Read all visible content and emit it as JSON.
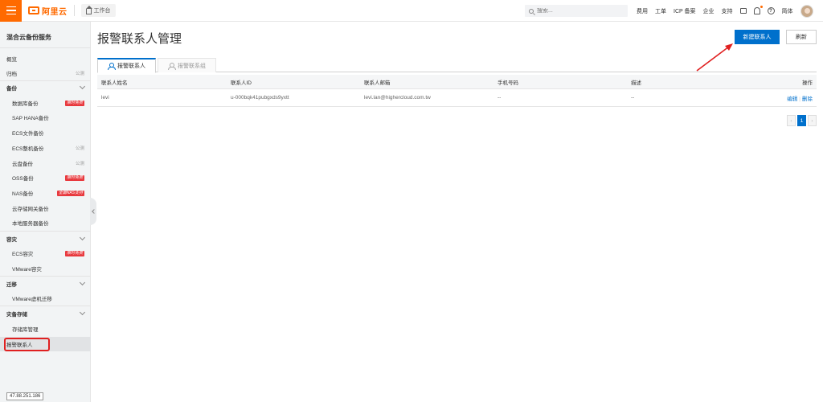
{
  "topbar": {
    "logo_text": "阿里云",
    "workbench_label": "工作台",
    "search_placeholder": "搜索...",
    "links": [
      "费用",
      "工单",
      "ICP 备案",
      "企业",
      "支持"
    ],
    "lang": "简体"
  },
  "sidebar": {
    "title": "混合云备份服务",
    "items": [
      {
        "label": "概览"
      },
      {
        "label": "归档",
        "tag": "公测"
      },
      {
        "label": "备份"
      },
      {
        "label": "数据库备份",
        "tag": "限时免费"
      },
      {
        "label": "SAP HANA备份"
      },
      {
        "label": "ECS文件备份"
      },
      {
        "label": "ECS整机备份",
        "tag": "公测"
      },
      {
        "label": "云盘备份",
        "tag": "公测"
      },
      {
        "label": "OSS备份",
        "tag": "限时免费"
      },
      {
        "label": "NAS备份",
        "tag": "全面NAS支持"
      },
      {
        "label": "云存储网关备份"
      },
      {
        "label": "本地服务器备份"
      },
      {
        "label": "容灾"
      },
      {
        "label": "ECS容灾",
        "tag": "限时免费"
      },
      {
        "label": "VMware容灾"
      },
      {
        "label": "迁移"
      },
      {
        "label": "VMware虚机迁移"
      },
      {
        "label": "灾备存储"
      },
      {
        "label": "存储库管理"
      },
      {
        "label": "报警联系人"
      }
    ],
    "ip": "47.88.251.186"
  },
  "main": {
    "title": "报警联系人管理",
    "new_button": "新建联系人",
    "refresh_button": "刷新",
    "tabs": [
      "报警联系人",
      "报警联系组"
    ],
    "columns": [
      "联系人姓名",
      "联系人ID",
      "联系人邮箱",
      "手机号码",
      "描述",
      "操作"
    ],
    "rows": [
      {
        "name": "levi",
        "id": "u-000bqk41pubgxds9yxtt",
        "email": "levi.lan@highercloud.com.tw",
        "phone": "--",
        "desc": "--",
        "edit": "编辑",
        "delete": "删除"
      }
    ],
    "pager": {
      "current": "1",
      "prev": "‹",
      "next": "›"
    }
  },
  "colors": {
    "brand": "#ff6a00",
    "primary": "#0070cc",
    "highlight": "#e02020",
    "tag_red": "#e8383d"
  }
}
